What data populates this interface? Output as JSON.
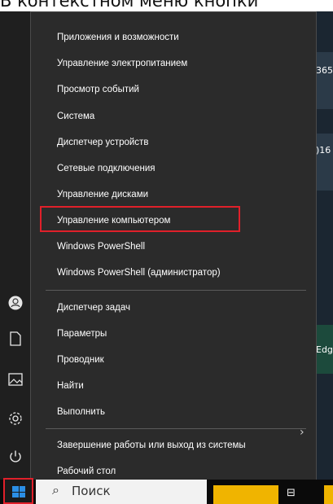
{
  "caption": "В контекстном меню кнопки",
  "desktop": {
    "label1": "365.",
    "label2": ")16",
    "label3": "Edge"
  },
  "menu": {
    "group1": [
      "Приложения и возможности",
      "Управление электропитанием",
      "Просмотр событий",
      "Система",
      "Диспетчер устройств",
      "Сетевые подключения",
      "Управление дисками",
      "Управление компьютером",
      "Windows PowerShell",
      "Windows PowerShell (администратор)"
    ],
    "group2": [
      "Диспетчер задач",
      "Параметры",
      "Проводник",
      "Найти",
      "Выполнить"
    ],
    "group3": [
      "Завершение работы или выход из системы",
      "Рабочий стол"
    ],
    "highlighted_item": "Управление компьютером"
  },
  "taskbar": {
    "search_placeholder": "Поиск"
  },
  "colors": {
    "menu_bg": "#2b2b2b",
    "highlight_border": "#e0202a",
    "start_icon": "#2b8fe6"
  }
}
